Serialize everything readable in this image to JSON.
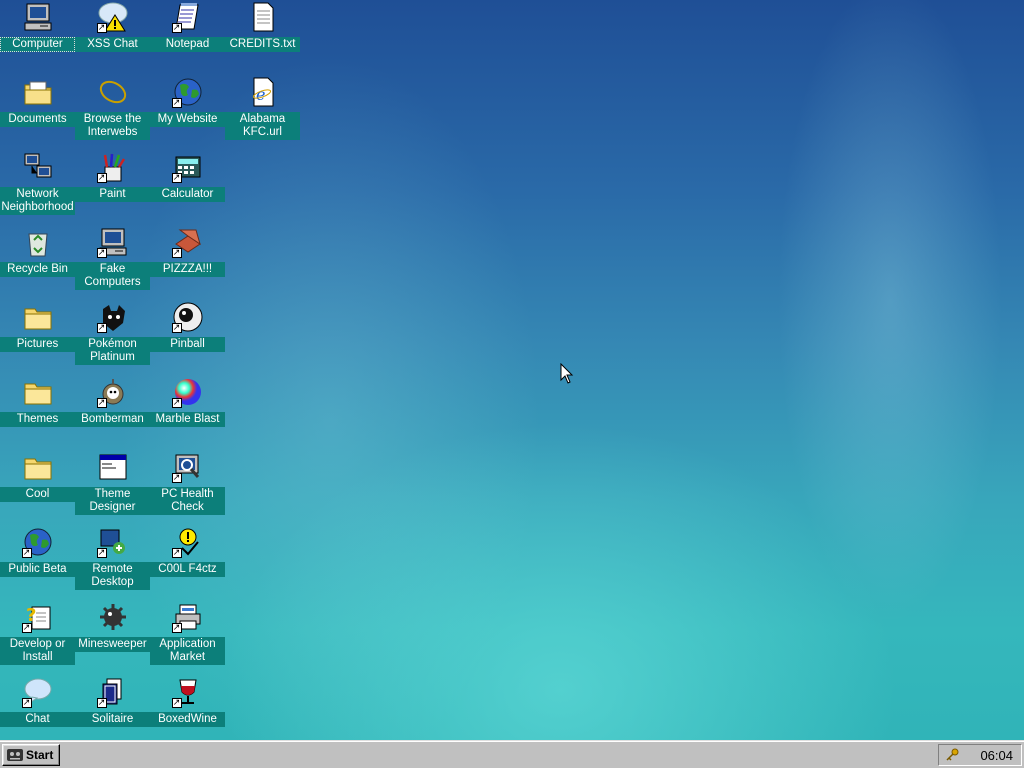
{
  "desktop": {
    "icons": [
      {
        "id": "computer",
        "label": "Computer",
        "icon": "computer-icon",
        "col": 0,
        "row": 0,
        "shortcut": false,
        "selected": true
      },
      {
        "id": "xss-chat",
        "label": "XSS Chat",
        "icon": "chat-warning-icon",
        "col": 1,
        "row": 0,
        "shortcut": true
      },
      {
        "id": "notepad",
        "label": "Notepad",
        "icon": "notepad-icon",
        "col": 2,
        "row": 0,
        "shortcut": true
      },
      {
        "id": "credits",
        "label": "CREDITS.txt",
        "icon": "text-file-icon",
        "col": 3,
        "row": 0,
        "shortcut": false
      },
      {
        "id": "documents",
        "label": "Documents",
        "icon": "documents-folder-icon",
        "col": 0,
        "row": 1,
        "shortcut": false
      },
      {
        "id": "browse",
        "label": "Browse the Interwebs",
        "icon": "browser-ring-icon",
        "col": 1,
        "row": 1,
        "shortcut": false
      },
      {
        "id": "my-website",
        "label": "My Website",
        "icon": "globe-icon",
        "col": 2,
        "row": 1,
        "shortcut": true
      },
      {
        "id": "alabama-kfc",
        "label": "Alabama KFC.url",
        "icon": "ie-document-icon",
        "col": 3,
        "row": 1,
        "shortcut": false
      },
      {
        "id": "network",
        "label": "Network Neighborhood",
        "icon": "network-icon",
        "col": 0,
        "row": 2,
        "shortcut": false
      },
      {
        "id": "paint",
        "label": "Paint",
        "icon": "paint-icon",
        "col": 1,
        "row": 2,
        "shortcut": true
      },
      {
        "id": "calculator",
        "label": "Calculator",
        "icon": "calculator-icon",
        "col": 2,
        "row": 2,
        "shortcut": true
      },
      {
        "id": "recycle-bin",
        "label": "Recycle Bin",
        "icon": "recycle-bin-icon",
        "col": 0,
        "row": 3,
        "shortcut": false
      },
      {
        "id": "fake-computers",
        "label": "Fake Computers",
        "icon": "computer-icon",
        "col": 1,
        "row": 3,
        "shortcut": true
      },
      {
        "id": "pizzza",
        "label": "PIZZZA!!!",
        "icon": "pizza-box-icon",
        "col": 2,
        "row": 3,
        "shortcut": true
      },
      {
        "id": "pictures",
        "label": "Pictures",
        "icon": "folder-icon",
        "col": 0,
        "row": 4,
        "shortcut": false
      },
      {
        "id": "pokemon",
        "label": "Pokémon Platinum",
        "icon": "pokemon-icon",
        "col": 1,
        "row": 4,
        "shortcut": true
      },
      {
        "id": "pinball",
        "label": "Pinball",
        "icon": "pinball-icon",
        "col": 2,
        "row": 4,
        "shortcut": true
      },
      {
        "id": "themes",
        "label": "Themes",
        "icon": "folder-icon",
        "col": 0,
        "row": 5,
        "shortcut": false
      },
      {
        "id": "bomberman",
        "label": "Bomberman",
        "icon": "bomberman-icon",
        "col": 1,
        "row": 5,
        "shortcut": true
      },
      {
        "id": "marble-blast",
        "label": "Marble Blast",
        "icon": "marble-icon",
        "col": 2,
        "row": 5,
        "shortcut": true
      },
      {
        "id": "cool",
        "label": "Cool",
        "icon": "folder-icon",
        "col": 0,
        "row": 6,
        "shortcut": false
      },
      {
        "id": "theme-designer",
        "label": "Theme Designer",
        "icon": "window-icon",
        "col": 1,
        "row": 6,
        "shortcut": false
      },
      {
        "id": "pc-health",
        "label": "PC Health Check",
        "icon": "health-check-icon",
        "col": 2,
        "row": 6,
        "shortcut": true
      },
      {
        "id": "public-beta",
        "label": "Public Beta",
        "icon": "globe-icon",
        "col": 0,
        "row": 7,
        "shortcut": true
      },
      {
        "id": "remote-desktop",
        "label": "Remote Desktop",
        "icon": "remote-desktop-icon",
        "col": 1,
        "row": 7,
        "shortcut": true
      },
      {
        "id": "cool-f4ctz",
        "label": "C00L F4ctz",
        "icon": "lightbulb-icon",
        "col": 2,
        "row": 7,
        "shortcut": true
      },
      {
        "id": "develop",
        "label": "Develop or Install",
        "icon": "help-document-icon",
        "col": 0,
        "row": 8,
        "shortcut": true
      },
      {
        "id": "minesweeper",
        "label": "Minesweeper",
        "icon": "mine-icon",
        "col": 1,
        "row": 8,
        "shortcut": false
      },
      {
        "id": "app-market",
        "label": "Application Market",
        "icon": "printer-icon",
        "col": 2,
        "row": 8,
        "shortcut": true
      },
      {
        "id": "chat",
        "label": "Chat",
        "icon": "speech-bubble-icon",
        "col": 0,
        "row": 9,
        "shortcut": true
      },
      {
        "id": "solitaire",
        "label": "Solitaire",
        "icon": "cards-icon",
        "col": 1,
        "row": 9,
        "shortcut": true
      },
      {
        "id": "boxedwine",
        "label": "BoxedWine",
        "icon": "wine-glass-icon",
        "col": 2,
        "row": 9,
        "shortcut": true
      }
    ]
  },
  "taskbar": {
    "start_label": "Start",
    "clock": "06:04",
    "tray_icon": "key-icon"
  },
  "colors": {
    "label_bg": "#0c7f7a",
    "taskbar": "#c0c0c0"
  }
}
